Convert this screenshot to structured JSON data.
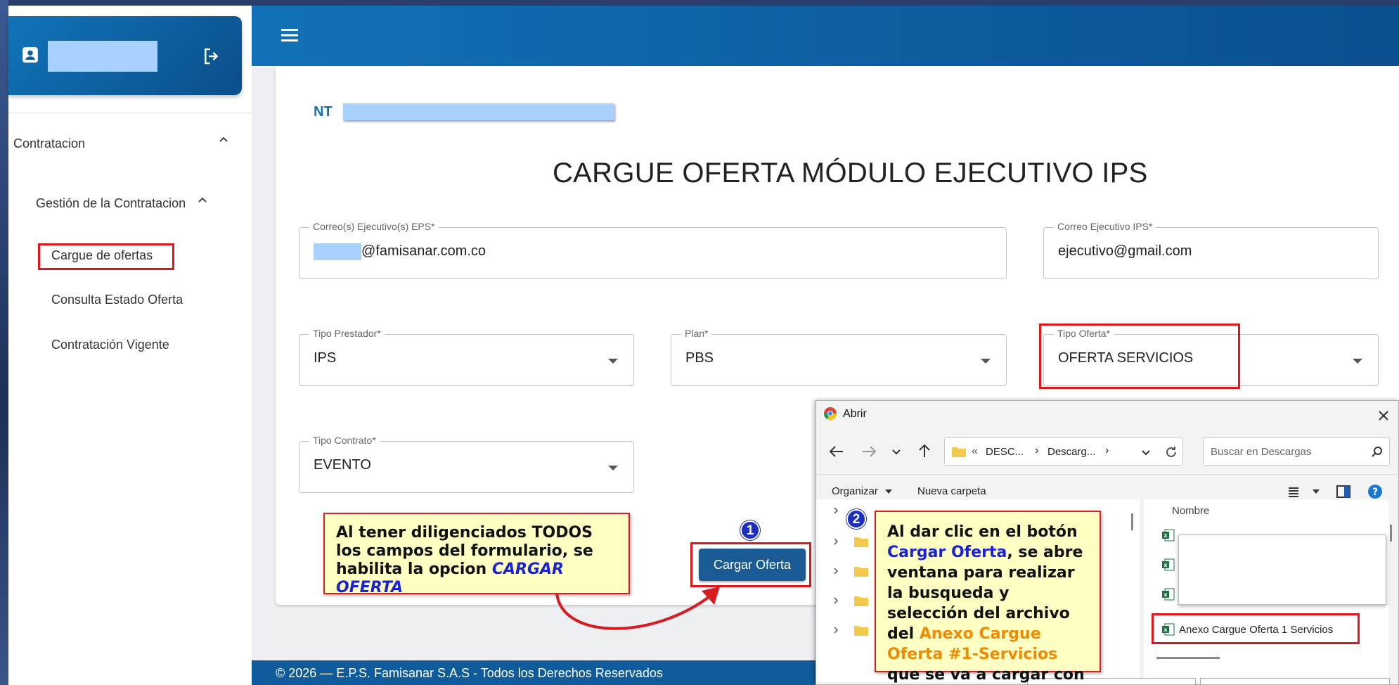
{
  "sidebar": {
    "sections": [
      {
        "label": "Contratacion"
      },
      {
        "label": "Gestión de la Contratacion"
      }
    ],
    "items": [
      {
        "label": "Cargue de ofertas"
      },
      {
        "label": "Consulta Estado Oferta"
      },
      {
        "label": "Contratación Vigente"
      }
    ]
  },
  "page": {
    "nt_label": "NT",
    "title": "CARGUE OFERTA MÓDULO EJECUTIVO IPS"
  },
  "form": {
    "correo_eps": {
      "label": "Correo(s) Ejecutivo(s) EPS",
      "value": "@famisanar.com.co"
    },
    "correo_ips": {
      "label": "Correo Ejecutivo IPS",
      "value": "ejecutivo@gmail.com"
    },
    "tipo_prestador": {
      "label": "Tipo Prestador",
      "value": "IPS"
    },
    "plan": {
      "label": "Plan",
      "value": "PBS"
    },
    "tipo_oferta": {
      "label": "Tipo Oferta",
      "value": "OFERTA SERVICIOS"
    },
    "tipo_contrato": {
      "label": "Tipo Contrato",
      "value": "EVENTO"
    },
    "required_mark": "*",
    "submit_label": "Cargar Oferta"
  },
  "footer": {
    "text": "© 2026 — E.P.S. Famisanar S.A.S - Todos los Derechos Reservados"
  },
  "callouts": {
    "one": {
      "badge": "1",
      "text_plain": "Al tener diligenciados TODOS los campos del formulario, se habilita la opcion ",
      "text_highlight": "CARGAR OFERTA"
    },
    "two": {
      "badge": "2",
      "t1": "Al dar clic en el botón ",
      "t2": "Cargar Oferta",
      "t3": ", se abre ventana para realizar la busqueda y selección del archivo del ",
      "t4": "Anexo Cargue Oferta #1-Servicios",
      "t5": " que se va a cargar con la oferta"
    }
  },
  "dialog": {
    "title": "Abrir",
    "path_prefix": "«",
    "path_1": "DESC...",
    "path_sep": "›",
    "path_2": "Descarg...",
    "search_placeholder": "Buscar en Descargas",
    "organize_label": "Organizar",
    "new_folder_label": "Nueva carpeta",
    "column_name": "Nombre",
    "selected_file": "Anexo Cargue Oferta 1 Servicios"
  },
  "colors": {
    "brand": "#1271b6",
    "highlight_red": "#e0161c",
    "callout_bg": "#ffffc4",
    "link_blue": "#1a22d6",
    "orange": "#f08a00"
  }
}
